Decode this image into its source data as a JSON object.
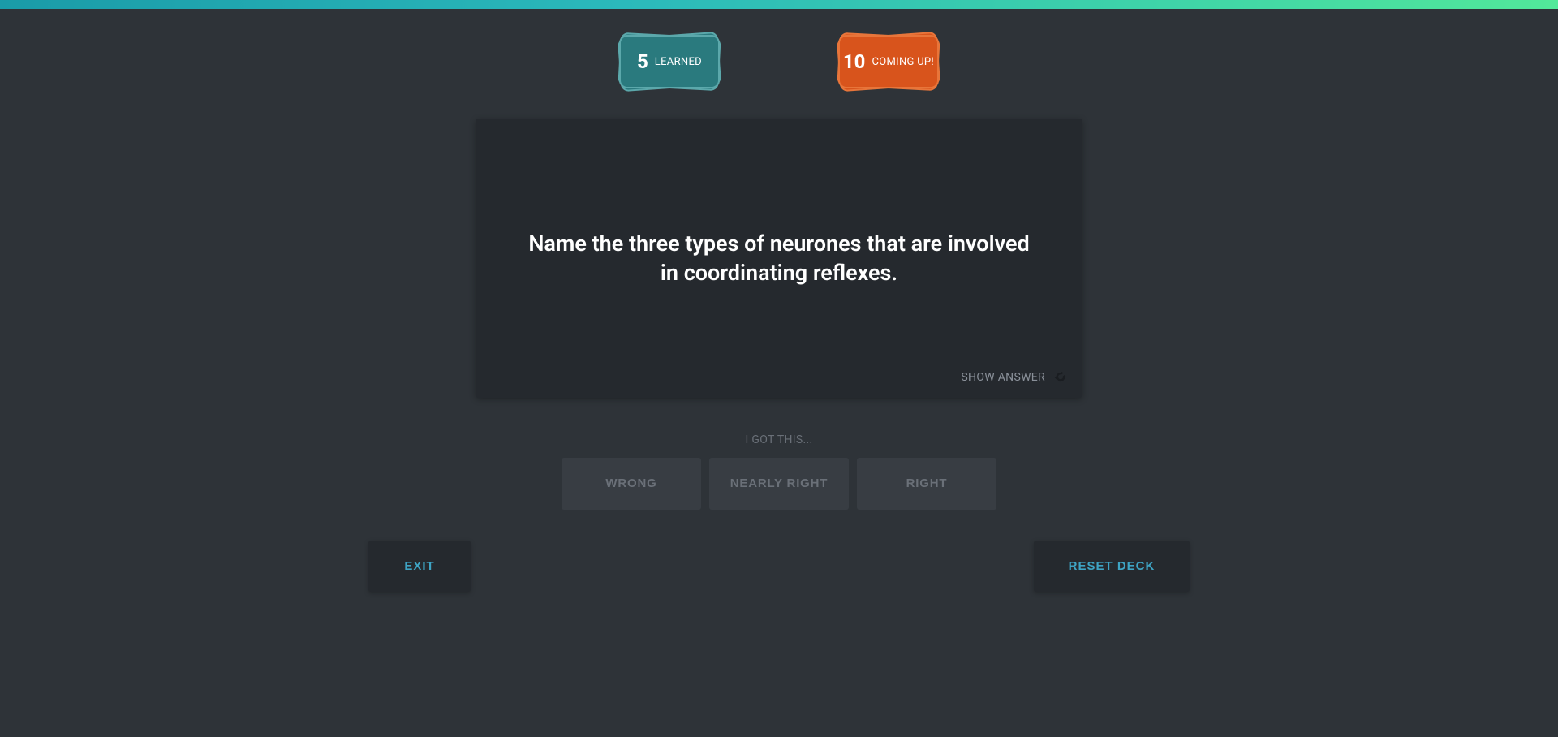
{
  "badges": {
    "learned": {
      "count": "5",
      "label": "LEARNED"
    },
    "coming": {
      "count": "10",
      "label": "COMING UP!"
    }
  },
  "flashcard": {
    "question": "Name the three types of neurones that are involved in coordinating reflexes.",
    "show_answer_label": "SHOW ANSWER"
  },
  "prompt": "I GOT THIS...",
  "answer_buttons": {
    "wrong": "WRONG",
    "nearly_right": "NEARLY RIGHT",
    "right": "RIGHT"
  },
  "actions": {
    "exit": "EXIT",
    "reset": "RESET DECK"
  }
}
